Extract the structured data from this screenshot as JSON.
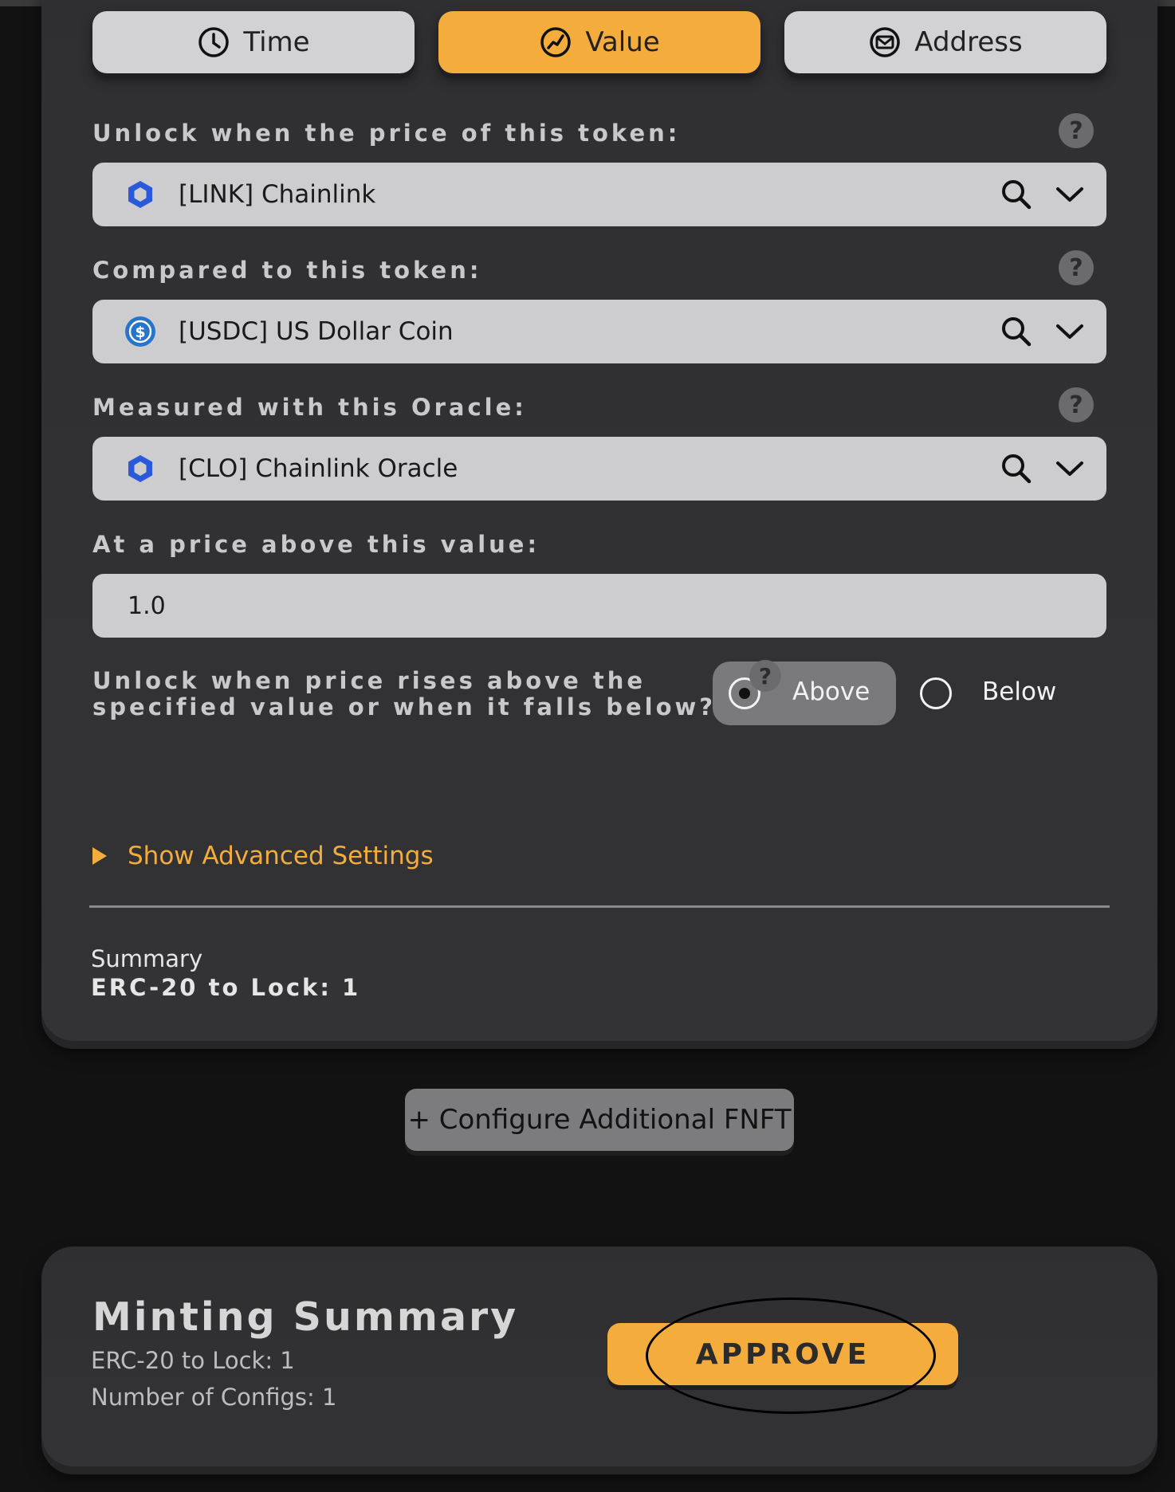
{
  "tabs": [
    {
      "label": "Time",
      "icon": "clock-icon",
      "active": false
    },
    {
      "label": "Value",
      "icon": "chart-icon",
      "active": true
    },
    {
      "label": "Address",
      "icon": "mail-icon",
      "active": false
    }
  ],
  "fields": {
    "unlock_token": {
      "label": "Unlock when the price of this token:",
      "value": "[LINK] Chainlink",
      "icon": "chainlink-icon"
    },
    "compare_token": {
      "label": "Compared to this token:",
      "value": "[USDC] US Dollar Coin",
      "icon": "usdc-icon"
    },
    "oracle": {
      "label": "Measured with this Oracle:",
      "value": "[CLO] Chainlink Oracle",
      "icon": "chainlink-icon"
    },
    "price": {
      "label": "At a price above this value:",
      "value": "1.0"
    }
  },
  "direction": {
    "question_line1": "Unlock when price rises above the",
    "question_line2": "specified value or when it falls below?",
    "options": [
      "Above",
      "Below"
    ],
    "selected": "Above"
  },
  "help_glyph": "?",
  "advanced": {
    "label": "Show Advanced Settings"
  },
  "summary": {
    "heading": "Summary",
    "value": "ERC-20 to Lock: 1"
  },
  "configure_button": "+ Configure Additional FNFT",
  "minting": {
    "title": "Minting Summary",
    "lines": [
      "ERC-20 to Lock: 1",
      "Number of Configs: 1"
    ],
    "approve_label": "APPROVE"
  },
  "colors": {
    "accent": "#f4ad3d",
    "card": "#313133",
    "field": "#cdcdcf",
    "background": "#121212"
  }
}
